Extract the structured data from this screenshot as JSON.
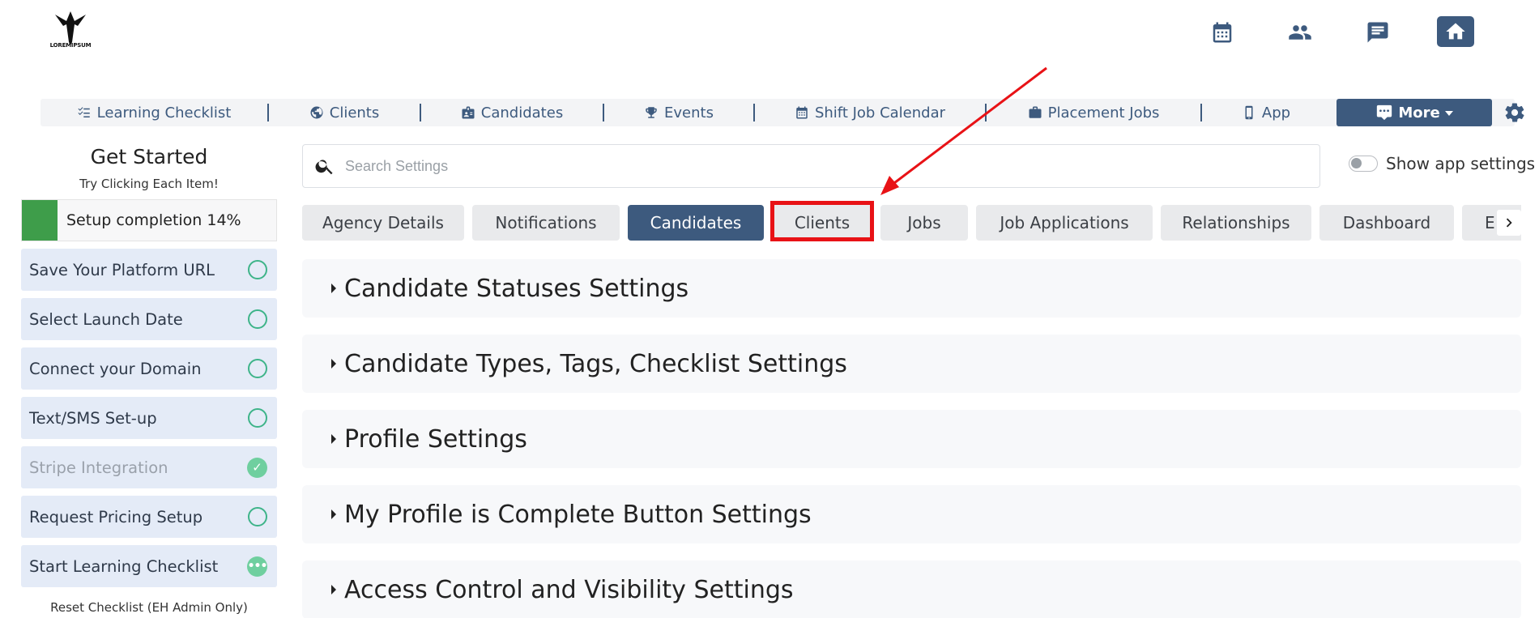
{
  "logo": {
    "name": "logo",
    "text": "LOREMIPSUM"
  },
  "top_icons": [
    {
      "icon": "calendar-icon"
    },
    {
      "icon": "people-icon"
    },
    {
      "icon": "chat-icon"
    },
    {
      "icon": "home-icon"
    }
  ],
  "nav": {
    "items": [
      {
        "label": "Learning Checklist",
        "icon": "checklist-icon"
      },
      {
        "label": "Clients",
        "icon": "globe-icon"
      },
      {
        "label": "Candidates",
        "icon": "id-badge-icon"
      },
      {
        "label": "Events",
        "icon": "trophy-icon"
      },
      {
        "label": "Shift Job Calendar",
        "icon": "calendar-icon"
      },
      {
        "label": "Placement Jobs",
        "icon": "briefcase-icon"
      },
      {
        "label": "App",
        "icon": "mobile-icon"
      }
    ],
    "more_label": "More",
    "more_icon": "comment-icon",
    "settings_icon": "gear-icon"
  },
  "sidebar": {
    "title": "Get Started",
    "subtitle": "Try Clicking Each Item!",
    "progress_label": "Setup completion 14%",
    "progress_percent": 14,
    "items": [
      {
        "label": "Save Your Platform URL",
        "status": "pending"
      },
      {
        "label": "Select Launch Date",
        "status": "pending"
      },
      {
        "label": "Connect your Domain",
        "status": "pending"
      },
      {
        "label": "Text/SMS Set-up",
        "status": "pending"
      },
      {
        "label": "Stripe Integration",
        "status": "done"
      },
      {
        "label": "Request Pricing Setup",
        "status": "pending"
      },
      {
        "label": "Start Learning Checklist",
        "status": "in-progress"
      }
    ],
    "reset_label": "Reset Checklist (EH Admin Only)"
  },
  "search": {
    "placeholder": "Search Settings",
    "value": ""
  },
  "toggle": {
    "label": "Show app settings",
    "on": false
  },
  "tabs": [
    {
      "label": "Agency Details",
      "active": false
    },
    {
      "label": "Notifications",
      "active": false
    },
    {
      "label": "Candidates",
      "active": true
    },
    {
      "label": "Clients",
      "active": false,
      "highlighted": true
    },
    {
      "label": "Jobs",
      "active": false
    },
    {
      "label": "Job Applications",
      "active": false
    },
    {
      "label": "Relationships",
      "active": false
    },
    {
      "label": "Dashboard",
      "active": false
    },
    {
      "label": "E",
      "active": false
    }
  ],
  "sections": [
    {
      "title": "Candidate Statuses Settings"
    },
    {
      "title": "Candidate Types, Tags, Checklist Settings"
    },
    {
      "title": "Profile Settings"
    },
    {
      "title": "My Profile is Complete Button Settings"
    },
    {
      "title": "Access Control and Visibility Settings"
    }
  ],
  "colors": {
    "primary": "#3d5a7e",
    "progress": "#3e9d4a",
    "check": "#3eb489",
    "annotation": "#e81216"
  }
}
